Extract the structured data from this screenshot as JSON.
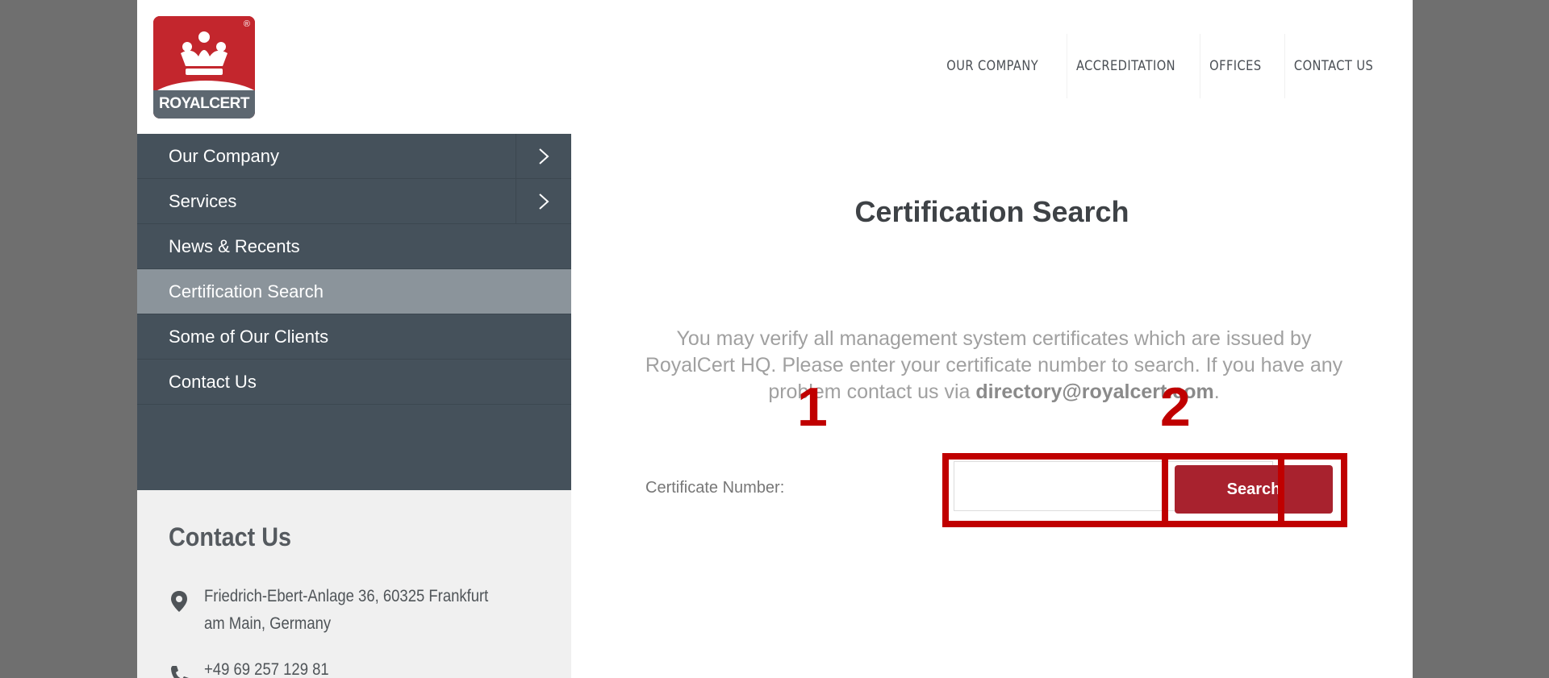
{
  "header": {
    "logo_text": "ROYALCERT",
    "logo_reg": "®",
    "nav": [
      "OUR COMPANY",
      "ACCREDITATION",
      "OFFICES",
      "CONTACT US"
    ]
  },
  "sidebar": {
    "items": [
      {
        "label": "Our Company",
        "has_arrow": true,
        "active": false
      },
      {
        "label": "Services",
        "has_arrow": true,
        "active": false
      },
      {
        "label": "News & Recents",
        "has_arrow": false,
        "active": false
      },
      {
        "label": "Certification Search",
        "has_arrow": false,
        "active": true
      },
      {
        "label": "Some of Our Clients",
        "has_arrow": false,
        "active": false
      },
      {
        "label": "Contact Us",
        "has_arrow": false,
        "active": false
      }
    ]
  },
  "contact": {
    "title": "Contact Us",
    "address": "Friedrich-Ebert-Anlage 36, 60325 Frankfurt am Main, Germany",
    "phone": "+49 69 257 129 81"
  },
  "main": {
    "title": "Certification Search",
    "desc_text": "You may verify all management system certificates which are issued by RoyalCert HQ. Please enter your certificate number to search. If you have any problem contact us via",
    "desc_email": "directory@royalcert.com",
    "desc_end": ".",
    "cert_label": "Certificate Number:",
    "cert_value": "",
    "search_label": "Search"
  },
  "annotations": {
    "num1": "1",
    "num2": "2"
  },
  "colors": {
    "sidebar_bg": "#45515b",
    "sidebar_active": "#8b949b",
    "brand_red": "#a8222e",
    "highlight": "#c00000"
  }
}
